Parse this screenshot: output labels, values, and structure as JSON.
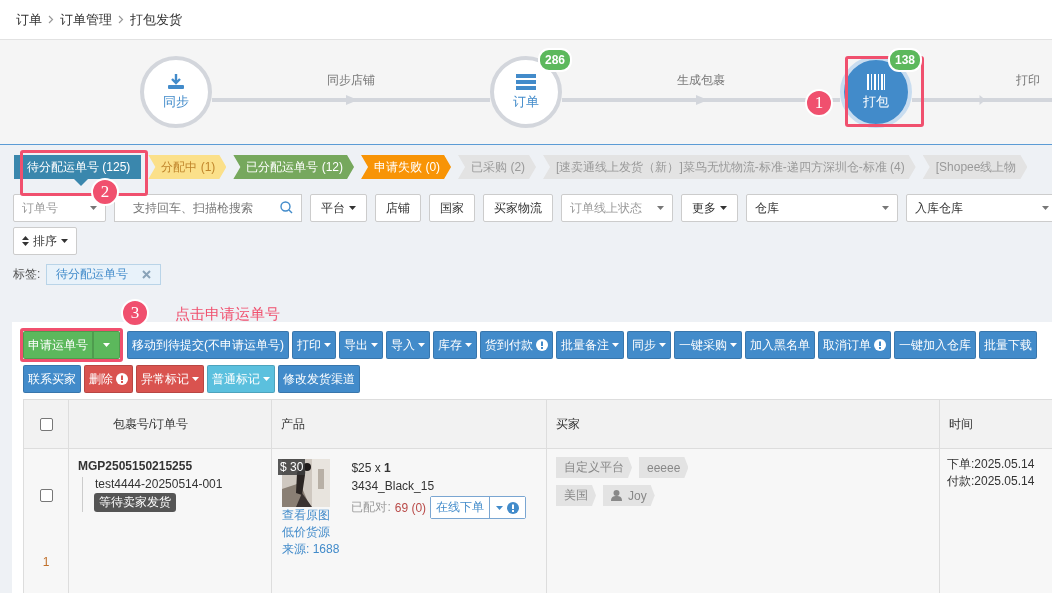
{
  "breadcrumb": [
    "订单",
    "订单管理",
    "打包发货"
  ],
  "steps": [
    {
      "kind": "download",
      "label": "同步",
      "selected": false
    },
    {
      "kind": "list",
      "label": "订单",
      "badge": "286",
      "selected": false
    },
    {
      "kind": "barcode",
      "label": "打包",
      "badge": "138",
      "selected": true
    }
  ],
  "step_connectors": [
    "同步店铺",
    "生成包裹",
    "打印"
  ],
  "status_tabs": [
    {
      "label": "待分配运单号 (125)",
      "color": "#3a87ad",
      "selected": true
    },
    {
      "label": "分配中 (1)",
      "color": "#fbe08a",
      "selected": false
    },
    {
      "label": "已分配运单号 (12)",
      "color": "#76a85d",
      "selected": false
    },
    {
      "label": "申请失败 (0)",
      "color": "#f89406",
      "selected": false
    },
    {
      "label": "已采购 (2)",
      "color": "#e3e3e3",
      "selected": false
    },
    {
      "label": "[速卖通线上发货（新）]菜鸟无忧物流-标准-递四方深圳仓-标准 (4)",
      "color": "#e3e3e3",
      "selected": false
    },
    {
      "label": "[Shopee线上物",
      "color": "#e3e3e3",
      "selected": false
    }
  ],
  "filters": [
    {
      "kind": "select",
      "placeholder": "订单号"
    },
    {
      "kind": "search",
      "placeholder": "支持回车、扫描枪搜索"
    },
    {
      "kind": "menu",
      "label": "平台"
    },
    {
      "kind": "button",
      "label": "店铺"
    },
    {
      "kind": "button",
      "label": "国家"
    },
    {
      "kind": "button",
      "label": "买家物流"
    },
    {
      "kind": "select",
      "placeholder": "订单线上状态"
    },
    {
      "kind": "menu",
      "label": "更多"
    },
    {
      "kind": "select",
      "value": "仓库"
    },
    {
      "kind": "select",
      "value": "入库仓库"
    }
  ],
  "sort_button": "排序",
  "tag_filter": {
    "label": "标签:",
    "tag": "待分配运单号"
  },
  "annotations": [
    "1",
    "2",
    "3"
  ],
  "note": "点击申请运单号",
  "action_rows": [
    [
      {
        "label": "申请运单号",
        "color": "#5cb85c",
        "split": true
      },
      {
        "label": "移动到待提交(不申请运单号)",
        "color": "#428bca"
      },
      {
        "label": "打印",
        "color": "#428bca",
        "caret": true
      },
      {
        "label": "导出",
        "color": "#428bca",
        "caret": true
      },
      {
        "label": "导入",
        "color": "#428bca",
        "caret": true
      },
      {
        "label": "库存",
        "color": "#428bca",
        "caret": true
      },
      {
        "label": "货到付款",
        "color": "#428bca",
        "alert": true
      },
      {
        "label": "批量备注",
        "color": "#428bca",
        "caret": true
      },
      {
        "label": "同步",
        "color": "#428bca",
        "caret": true
      },
      {
        "label": "一键采购",
        "color": "#428bca",
        "caret": true
      },
      {
        "label": "加入黑名单",
        "color": "#428bca"
      },
      {
        "label": "取消订单",
        "color": "#428bca",
        "alert": true
      },
      {
        "label": "一键加入仓库",
        "color": "#428bca"
      },
      {
        "label": "批量下载",
        "color": "#428bca"
      }
    ],
    [
      {
        "label": "联系买家",
        "color": "#428bca"
      },
      {
        "label": "删除",
        "color": "#d9534f",
        "alert": true
      },
      {
        "label": "异常标记",
        "color": "#d9534f",
        "caret": true
      },
      {
        "label": "普通标记",
        "color": "#5bc0de",
        "caret": true
      },
      {
        "label": "修改发货渠道",
        "color": "#428bca"
      }
    ]
  ],
  "table": {
    "select_all_checked": false,
    "columns": [
      "包裹号/订单号",
      "产品",
      "买家",
      "时间"
    ],
    "rows": [
      {
        "index": "1",
        "checked": false,
        "package": "MGP2505150215255",
        "order": "test4444-20250514-001",
        "status": "等待卖家发货",
        "product": {
          "price_tag": "$ 30",
          "price_qty": "$25 x **1**",
          "sku": "3434_Black_15",
          "paired_label": "已配对:",
          "paired": "69",
          "paired_extra": "(0)",
          "order_button": "在线下单",
          "links": [
            "查看原图",
            "低价货源",
            "来源: 1688"
          ]
        },
        "buyer_tags": [
          [
            "自定义平台",
            "eeeee"
          ],
          [
            "美国",
            "Joy"
          ]
        ],
        "times": [
          "下单:2025.05.14",
          "付款:2025.05.14"
        ]
      }
    ]
  }
}
